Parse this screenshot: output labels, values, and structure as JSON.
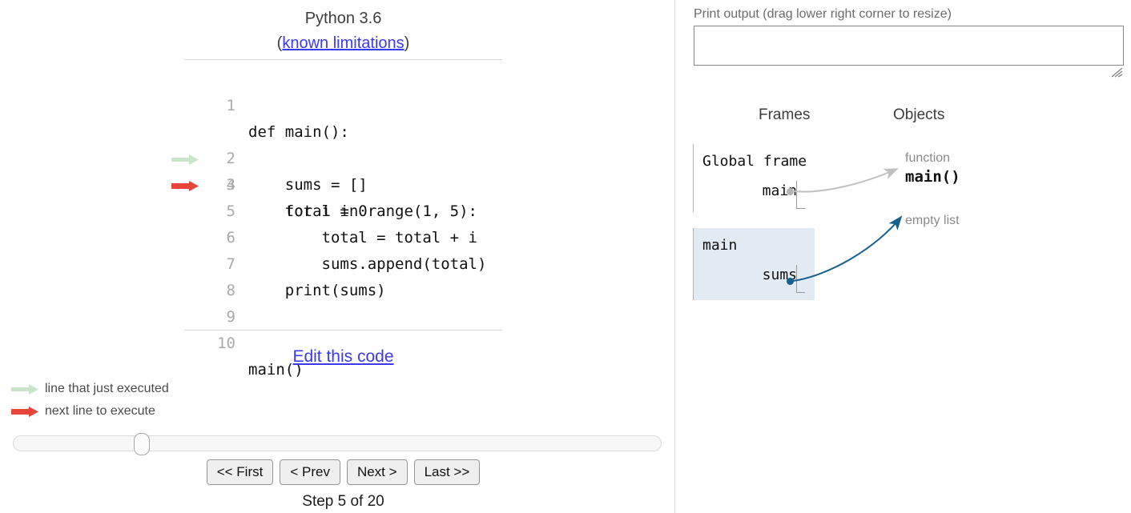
{
  "left": {
    "python_version": "Python 3.6",
    "limitations_prefix": "(",
    "limitations_link": "known limitations",
    "limitations_suffix": ")",
    "code_lines": [
      {
        "num": "1",
        "text": "def main():",
        "marker": "none"
      },
      {
        "num": "2",
        "text": "    sums = []",
        "marker": "green"
      },
      {
        "num": "3",
        "text": "    total = 0",
        "marker": "red"
      },
      {
        "num": "4",
        "text": "    for i in range(1, 5):",
        "marker": "none"
      },
      {
        "num": "5",
        "text": "        total = total + i",
        "marker": "none"
      },
      {
        "num": "6",
        "text": "        sums.append(total)",
        "marker": "none"
      },
      {
        "num": "7",
        "text": "    print(sums)",
        "marker": "none"
      },
      {
        "num": "8",
        "text": "",
        "marker": "none"
      },
      {
        "num": "9",
        "text": "",
        "marker": "none"
      },
      {
        "num": "10",
        "text": "main()",
        "marker": "none"
      }
    ],
    "edit_link": "Edit this code",
    "legend": {
      "just_executed": "line that just executed",
      "next_line": "next line to execute"
    },
    "nav": {
      "first": "<< First",
      "prev": "< Prev",
      "next": "Next >",
      "last": "Last >>"
    },
    "step_counter": "Step 5 of 20",
    "slider_position_percent": 17
  },
  "right": {
    "print_output_label": "Print output (drag lower right corner to resize)",
    "print_output_value": "",
    "frames_header": "Frames",
    "objects_header": "Objects",
    "frames": [
      {
        "title": "Global frame",
        "variable": "main",
        "highlighted": false
      },
      {
        "title": "main",
        "variable": "sums",
        "highlighted": true
      }
    ],
    "objects": [
      {
        "label": "function",
        "value": "main()"
      },
      {
        "label": "empty list",
        "value": ""
      }
    ]
  },
  "colors": {
    "green_arrow": "#c9e5c9",
    "red_arrow": "#e8443a",
    "link_blue": "#3a3af0",
    "frame_highlight": "#e2eaf4",
    "pointer_blue": "#17618f",
    "pointer_gray": "#c0c0c0",
    "gutter_gray": "#aaaaaa"
  }
}
